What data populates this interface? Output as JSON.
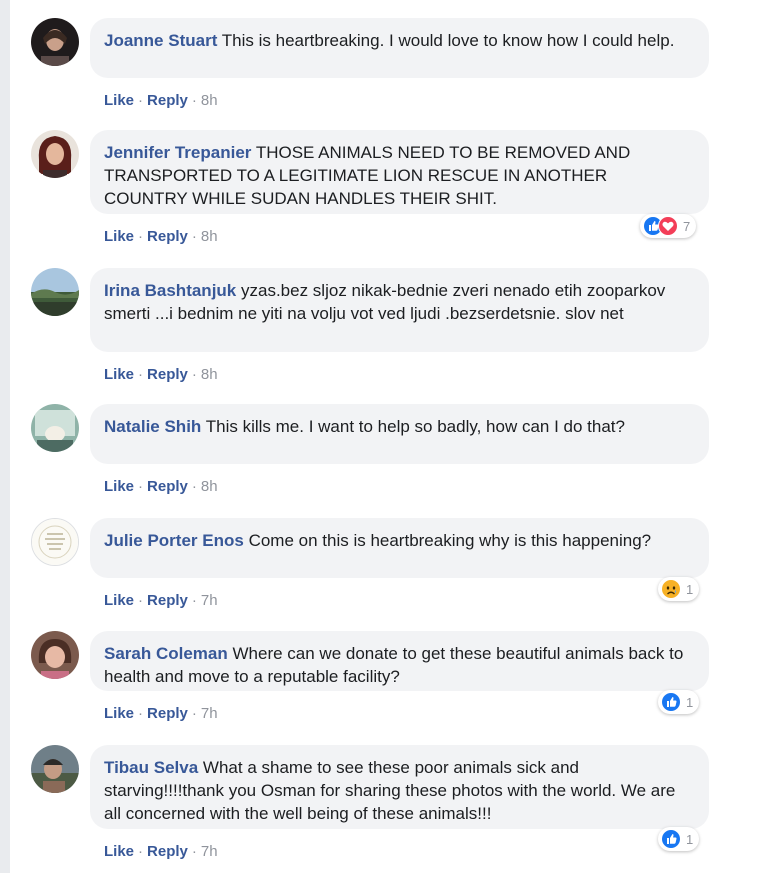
{
  "comments": [
    {
      "author": "Joanne Stuart",
      "text": "This is heartbreaking. I would love to know how I could help.",
      "like": "Like",
      "sep": "·",
      "reply": "Reply",
      "time": "8h"
    },
    {
      "author": "Jennifer Trepanier",
      "text": "THOSE ANIMALS NEED TO BE REMOVED AND TRANSPORTED TO A LEGITIMATE LION RESCUE IN ANOTHER COUNTRY WHILE SUDAN HANDLES THEIR SHIT.",
      "like": "Like",
      "sep": "·",
      "reply": "Reply",
      "time": "8h",
      "reactions": {
        "icons": [
          "like-icon",
          "love-icon"
        ],
        "count": "7"
      }
    },
    {
      "author": "Irina Bashtanjuk",
      "text": "yzas.bez sljoz nikak-bednie zveri nenado etih zooparkov smerti ...i bednim ne yiti na volju vot ved ljudi .bezserdetsnie. slov net",
      "like": "Like",
      "sep": "·",
      "reply": "Reply",
      "time": "8h"
    },
    {
      "author": "Natalie Shih",
      "text": "This kills me. I want to help so badly, how can I do that?",
      "like": "Like",
      "sep": "·",
      "reply": "Reply",
      "time": "8h"
    },
    {
      "author": "Julie Porter Enos",
      "text": "Come on this is heartbreaking why is this happening?",
      "like": "Like",
      "sep": "·",
      "reply": "Reply",
      "time": "7h",
      "reactions": {
        "icons": [
          "sad-icon"
        ],
        "count": "1"
      }
    },
    {
      "author": "Sarah Coleman",
      "text": "Where can we donate to get these beautiful animals back to health and move to a reputable facility?",
      "like": "Like",
      "sep": "·",
      "reply": "Reply",
      "time": "7h",
      "reactions": {
        "icons": [
          "like-icon"
        ],
        "count": "1"
      }
    },
    {
      "author": "Tibau Selva",
      "text": "What a shame to see these poor animals sick and starving!!!!thank you Osman for sharing these photos with the world. We are all concerned with the well being of these animals!!!",
      "like": "Like",
      "sep": "·",
      "reply": "Reply",
      "time": "7h",
      "reactions": {
        "icons": [
          "like-icon"
        ],
        "count": "1"
      }
    }
  ],
  "colors": {
    "author_link": "#385898",
    "bubble_bg": "#f2f3f5",
    "meta_gray": "#90949c",
    "like_blue": "#1877f2",
    "love_red": "#f33e58",
    "sad_yellow": "#f7b125"
  }
}
